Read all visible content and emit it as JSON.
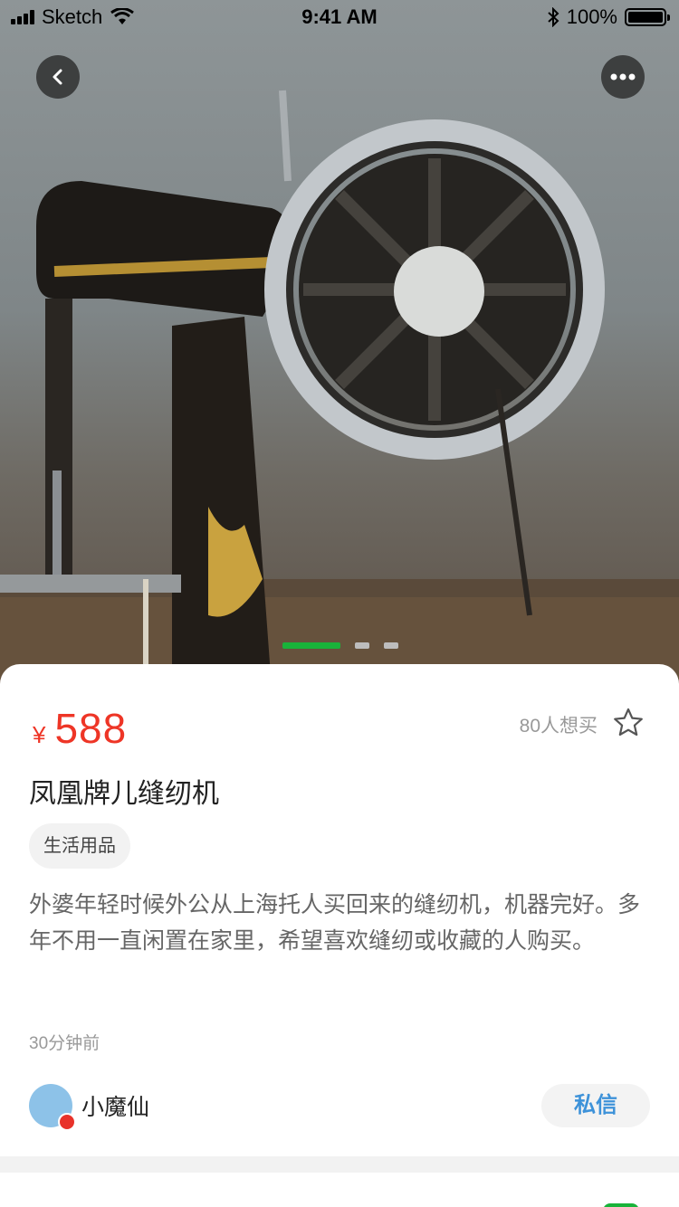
{
  "status_bar": {
    "carrier": "Sketch",
    "time": "9:41 AM",
    "battery": "100%",
    "battery_level": 1.0
  },
  "hero": {
    "image_subject": "sewing machine photo",
    "carousel_count": 3,
    "carousel_active_index": 0,
    "active_dot_color": "#19b33a"
  },
  "product": {
    "currency_symbol": "¥",
    "price": "588",
    "want_count_text": "80人想买",
    "title": "凤凰牌儿缝纫机",
    "category_tag": "生活用品",
    "description": "外婆年轻时候外公从上海托人买回来的缝纫机，机器完好。多年不用一直闲置在家里，希望喜欢缝纫或收藏的人购买。",
    "posted_time": "30分钟前"
  },
  "seller": {
    "name": "小魔仙",
    "message_button": "私信"
  },
  "colors": {
    "price": "#ee3526",
    "message_button_text": "#3d92d9",
    "accent_green": "#19b33a"
  },
  "icons": {
    "back": "chevron-left-icon",
    "more": "more-dots-icon",
    "favorite": "star-outline-icon",
    "wifi": "wifi-icon",
    "bluetooth": "bluetooth-icon"
  }
}
